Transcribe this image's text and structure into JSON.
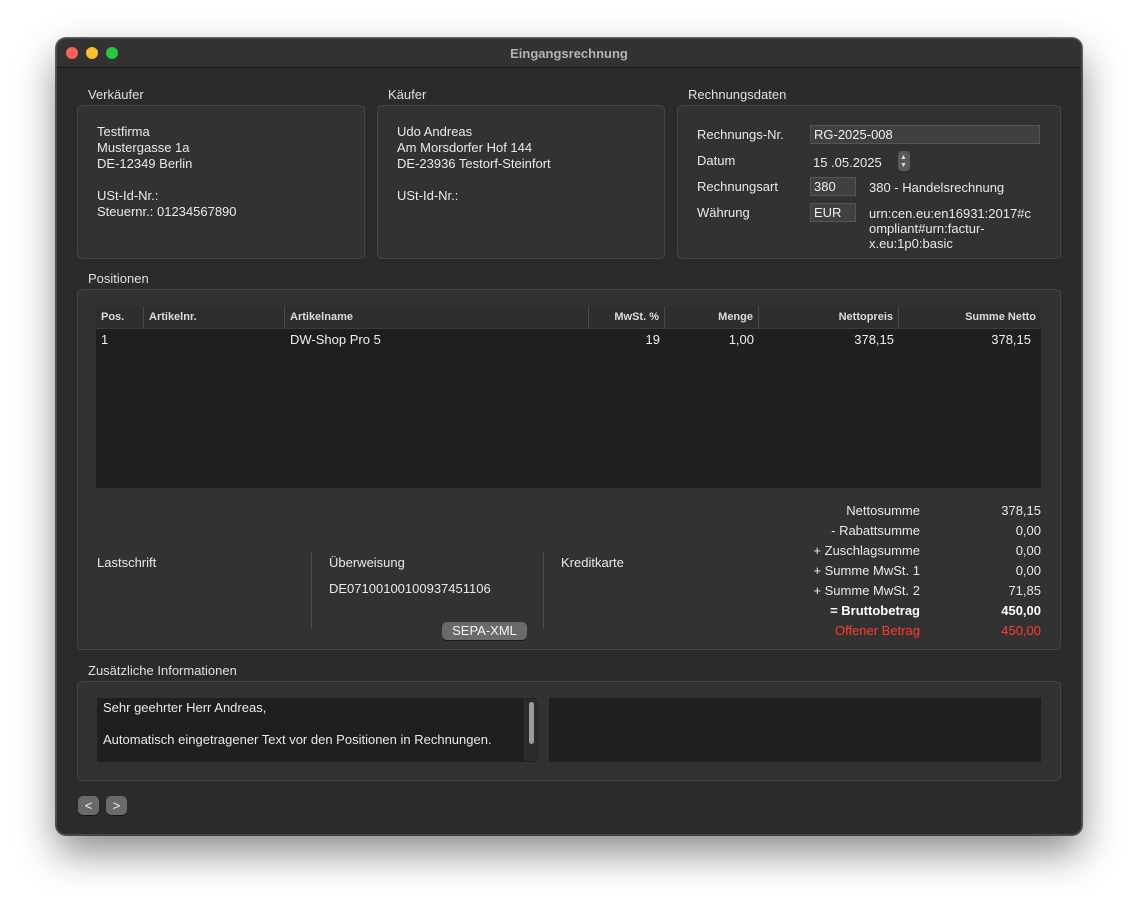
{
  "window": {
    "title": "Eingangsrechnung"
  },
  "seller": {
    "label": "Verkäufer",
    "name": "Testfirma",
    "street": "Mustergasse 1a",
    "city": "DE-12349 Berlin",
    "vat_id": "USt-Id-Nr.:",
    "tax_no": "Steuernr.: 01234567890"
  },
  "buyer": {
    "label": "Käufer",
    "name": "Udo Andreas",
    "street": "Am Morsdorfer Hof 144",
    "city": "DE-23936 Testorf-Steinfort",
    "vat_id": "USt-Id-Nr.:"
  },
  "invoice": {
    "label": "Rechnungsdaten",
    "number_label": "Rechnungs-Nr.",
    "number_value": "RG-2025-008",
    "date_label": "Datum",
    "date_value": "15 .05.2025",
    "type_label": "Rechnungsart",
    "type_code": "380",
    "type_desc": "380 - Handelsrechnung",
    "currency_label": "Währung",
    "currency_value": "EUR",
    "profile_line1": "urn:cen.eu:en16931:2017#c",
    "profile_line2": "ompliant#urn:factur-",
    "profile_line3": "x.eu:1p0:basic"
  },
  "positions": {
    "label": "Positionen",
    "columns": [
      "Pos.",
      "Artikelnr.",
      "Artikelname",
      "MwSt. %",
      "Menge",
      "Nettopreis",
      "Summe Netto"
    ],
    "rows": [
      {
        "pos": "1",
        "article_no": "",
        "name": "DW-Shop Pro 5",
        "vat": "19",
        "qty": "1,00",
        "net_price": "378,15",
        "net_sum": "378,15"
      }
    ]
  },
  "payment": {
    "direct_debit_label": "Lastschrift",
    "transfer_label": "Überweisung",
    "iban": "DE07100100100937451106",
    "sepa_button": "SEPA-XML",
    "credit_card_label": "Kreditkarte"
  },
  "totals": {
    "net_label": "Nettosumme",
    "net_value": "378,15",
    "discount_label": "- Rabattsumme",
    "discount_value": "0,00",
    "surcharge_label": "+ Zuschlagsumme",
    "surcharge_value": "0,00",
    "vat1_label": "+ Summe MwSt. 1",
    "vat1_value": "0,00",
    "vat2_label": "+ Summe MwSt. 2",
    "vat2_value": "71,85",
    "gross_label": "= Bruttobetrag",
    "gross_value": "450,00",
    "open_label": "Offener Betrag",
    "open_value": "450,00",
    "open_color": "#ff3b30"
  },
  "additional": {
    "label": "Zusätzliche Informationen",
    "line1": "Sehr geehrter Herr Andreas,",
    "line2": "Automatisch eingetragener Text vor den Positionen in Rechnungen."
  },
  "nav": {
    "prev": "<",
    "next": ">"
  }
}
